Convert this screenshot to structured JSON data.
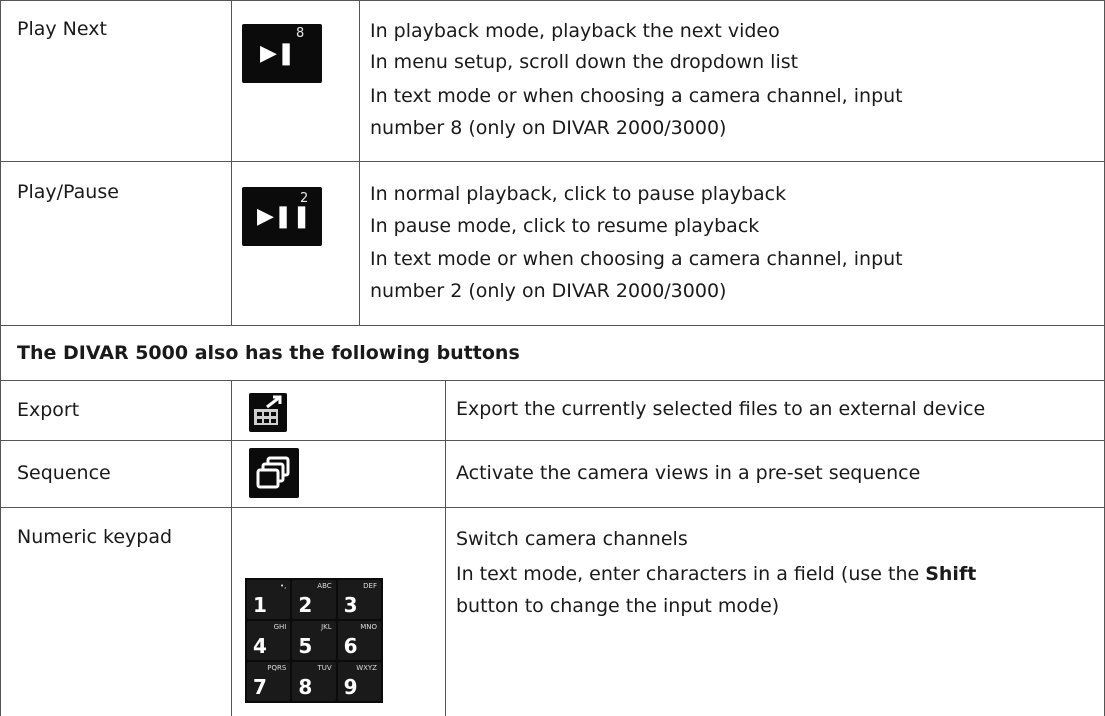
{
  "rows": [
    {
      "name": "Play Next",
      "icon": "play-next-icon",
      "icon_number": "8",
      "lines": [
        "In playback mode, playback the next video",
        "In menu setup, scroll down the dropdown list",
        "In text mode or when choosing a camera channel, input",
        "number 8 (only on DIVAR 2000/3000)"
      ]
    },
    {
      "name": "Play/Pause",
      "icon": "play-pause-icon",
      "icon_number": "2",
      "lines": [
        "In normal playback, click to pause playback",
        "In pause mode, click to resume playback",
        "In text mode or when choosing a camera channel, input",
        "number 2 (only on DIVAR 2000/3000)"
      ]
    }
  ],
  "section_header": "The DIVAR 5000 also has the following buttons",
  "rows2": [
    {
      "name": "Export",
      "icon": "export-icon",
      "lines": [
        "Export the currently selected files to an external device"
      ]
    },
    {
      "name": "Sequence",
      "icon": "sequence-icon",
      "lines": [
        "Activate the camera views in a pre-set sequence"
      ]
    },
    {
      "name": "Numeric keypad",
      "icon": "numeric-keypad-icon",
      "lines": [
        "Switch camera channels"
      ],
      "line2_pre": "In text mode, enter characters in a field (use the ",
      "line2_bold": "Shift",
      "line3": "button to change the input mode)",
      "keys": [
        {
          "digit": "1",
          "letters": "•,"
        },
        {
          "digit": "2",
          "letters": "ABC"
        },
        {
          "digit": "3",
          "letters": "DEF"
        },
        {
          "digit": "4",
          "letters": "GHI"
        },
        {
          "digit": "5",
          "letters": "JKL"
        },
        {
          "digit": "6",
          "letters": "MNO"
        },
        {
          "digit": "7",
          "letters": "PQRS"
        },
        {
          "digit": "8",
          "letters": "TUV"
        },
        {
          "digit": "9",
          "letters": "WXYZ"
        }
      ]
    }
  ],
  "colors": {
    "icon_bg": "#0b0b0b",
    "border": "#555555"
  }
}
